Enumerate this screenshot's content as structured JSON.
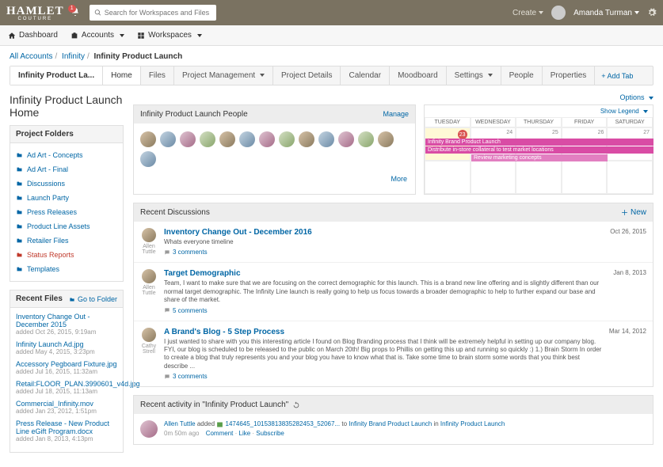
{
  "brand": {
    "name": "HAMLET",
    "sub": "COUTURE"
  },
  "notif_count": "1",
  "search": {
    "placeholder": "Search for Workspaces and Files"
  },
  "topnav": {
    "create": "Create",
    "user": "Amanda Turman"
  },
  "nav2": {
    "dashboard": "Dashboard",
    "accounts": "Accounts",
    "workspaces": "Workspaces"
  },
  "crumbs": {
    "root": "All Accounts",
    "acct": "Infinity",
    "current": "Infinity Product Launch"
  },
  "tabbar": {
    "title": "Infinity Product La...",
    "tabs": [
      "Home",
      "Files",
      "Project Management",
      "Project Details",
      "Calendar",
      "Moodboard",
      "Settings",
      "People",
      "Properties"
    ],
    "addtab": "+ Add Tab"
  },
  "page_title": "Infinity Product Launch Home",
  "options": "Options",
  "folders": {
    "header": "Project Folders",
    "items": [
      {
        "label": "Ad Art - Concepts"
      },
      {
        "label": "Ad Art - Final"
      },
      {
        "label": "Discussions"
      },
      {
        "label": "Launch Party"
      },
      {
        "label": "Press Releases"
      },
      {
        "label": "Product Line Assets"
      },
      {
        "label": "Retailer Files"
      },
      {
        "label": "Status Reports",
        "red": true
      },
      {
        "label": "Templates"
      }
    ]
  },
  "recent_files": {
    "header": "Recent Files",
    "goto": "Go to Folder",
    "items": [
      {
        "name": "Inventory Change Out - December 2015",
        "meta": "added Oct 26, 2015, 9:19am"
      },
      {
        "name": "Infinity Launch Ad.jpg",
        "meta": "added May 4, 2015, 3:23pm"
      },
      {
        "name": "Accessory Pegboard Fixture.jpg",
        "meta": "added Jul 16, 2015, 11:32am"
      },
      {
        "name": "Retail:FLOOR_PLAN.3990601_v4d.jpg",
        "meta": "added Jul 18, 2015, 11:13am"
      },
      {
        "name": "Commercial_Infinity.mov",
        "meta": "added Jan 23, 2012, 1:51pm"
      },
      {
        "name": "Press Release - New Product Line eGift Program.docx",
        "meta": "added Jan 8, 2013, 4:13pm"
      }
    ]
  },
  "people": {
    "header": "Infinity Product Launch People",
    "manage": "Manage",
    "more": "More"
  },
  "calendar": {
    "legend": "Show Legend",
    "days": [
      "TUESDAY",
      "WEDNESDAY",
      "THURSDAY",
      "FRIDAY",
      "SATURDAY"
    ],
    "dates": [
      "23",
      "24",
      "25",
      "26",
      "27"
    ],
    "events": [
      "Infinity Brand Product Launch",
      "Distribute in-store collateral to test market locations",
      "Review marketing concepts"
    ]
  },
  "discussions": {
    "header": "Recent Discussions",
    "new": "New",
    "items": [
      {
        "author": "Allen Tuttle",
        "title": "Inventory Change Out - December 2016",
        "text": "Whats everyone timeline",
        "comments": "3 comments",
        "date": "Oct 26, 2015"
      },
      {
        "author": "Allen Tuttle",
        "title": "Target Demographic",
        "text": "Team,  I want to make sure that we are focusing on the correct demographic for this launch. This is a brand new line offering and is slightly different than our normal target demographic. The Infinity Line launch is really going to help us focus towards a broader demographic to help to further expand our base and share of the market.",
        "comments": "5 comments",
        "date": "Jan 8, 2013"
      },
      {
        "author": "Cathy Strell",
        "title": "A Brand's Blog - 5 Step Process",
        "text": "I just wanted to share with you this interesting article I found on Blog Branding process that I think will be extremely helpful in setting up our company blog. FYI, our blog is scheduled to be released to the public on March 20th! Big props to Phillis on getting this up and running so quickly :)  1.) Brain Storm In order to create a blog that truly represents you and your blog you have to know what that is. Take some time to brain storm some words that you think best describe ...",
        "comments": "3 comments",
        "date": "Mar 14, 2012"
      }
    ]
  },
  "activity": {
    "header": "Recent activity in \"Infinity Product Launch\"",
    "item": {
      "user": "Allen Tuttle",
      "verb": "added",
      "file": "1474645_10153813835282453_52067...",
      "to_label": "to",
      "target1": "Infinity Brand Product Launch",
      "in_label": "in",
      "target2": "Infinity Product Launch",
      "time": "0m 50m ago",
      "actions": [
        "Comment",
        "Like",
        "Subscribe"
      ]
    }
  }
}
